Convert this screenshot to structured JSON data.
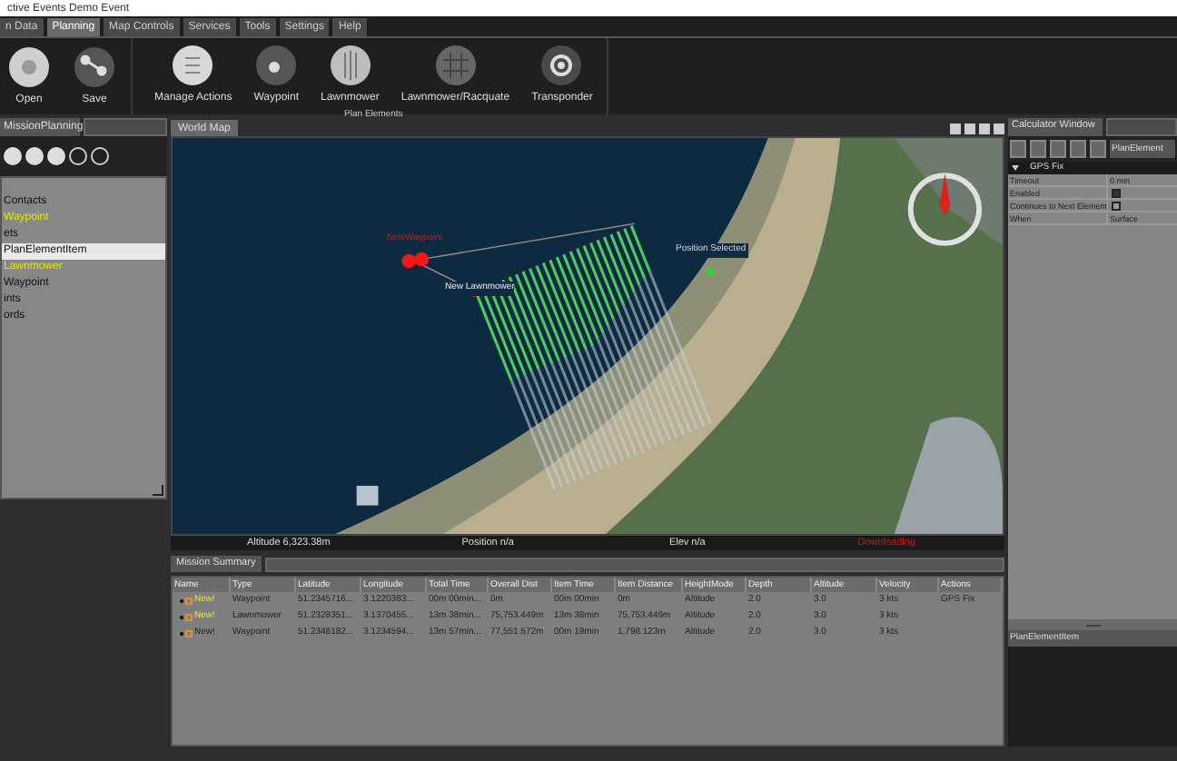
{
  "window": {
    "title": "ctive Events Demo Event"
  },
  "menu_tabs": [
    {
      "label": "n Data",
      "selected": false
    },
    {
      "label": "Planning",
      "selected": true
    },
    {
      "label": "Map Controls",
      "selected": false
    },
    {
      "label": "Services",
      "selected": false
    },
    {
      "label": "Tools",
      "selected": false
    },
    {
      "label": "Settings",
      "selected": false
    },
    {
      "label": "Help",
      "selected": false
    }
  ],
  "toolbar": {
    "file_buttons": [
      {
        "label": "Open",
        "kind": "open"
      },
      {
        "label": "Save",
        "kind": "save"
      }
    ],
    "plan_buttons": [
      {
        "label": "Manage Actions",
        "kind": "actions"
      },
      {
        "label": "Waypoint",
        "kind": "waypoint"
      },
      {
        "label": "Lawnmower",
        "kind": "lawnmower"
      },
      {
        "label": "Lawnmower/Racquate",
        "kind": "grid"
      },
      {
        "label": "Transponder",
        "kind": "transponder"
      }
    ],
    "group_label": "Plan Elements"
  },
  "left_panel": {
    "dropdown": "MissionPlanning",
    "items": [
      {
        "label": "Contacts",
        "selected": false,
        "color": "#111111"
      },
      {
        "label": "Waypoint",
        "selected": false,
        "color": "#e8e800"
      },
      {
        "label": "ets",
        "selected": false,
        "color": "#111111"
      },
      {
        "label": "PlanElementItem",
        "selected": true,
        "color": "#111111"
      },
      {
        "label": "Lawnmower",
        "selected": false,
        "color": "#e8e800"
      },
      {
        "label": "Waypoint",
        "selected": false,
        "color": "#111111"
      },
      {
        "label": "ints",
        "selected": false,
        "color": "#111111"
      },
      {
        "label": "ords",
        "selected": false,
        "color": "#111111"
      }
    ]
  },
  "map": {
    "tab": "World Map",
    "labels": {
      "waypoint": "NewWaypoint",
      "lawnmower": "New Lawnmower",
      "position": "Position Selected"
    },
    "status": [
      "Altitude 6,323.38m",
      "Position n/a",
      "Elev n/a"
    ],
    "download_status": "Downloading"
  },
  "mission_summary": {
    "title": "Mission Summary",
    "columns": [
      "Name",
      "Type",
      "Latitude",
      "Longitude",
      "Total Time",
      "Overall Dist",
      "Item Time",
      "Item Distance",
      "HeightMode",
      "Depth",
      "Altitude",
      "Velocity",
      "Actions"
    ],
    "rows": [
      {
        "highlighted": true,
        "cells": [
          "New!",
          "Waypoint",
          "51.2345716...",
          "3.1220383...",
          "00m 00min...",
          "0m",
          "00m 00min",
          "0m",
          "Altitude",
          "2.0",
          "3.0",
          "3 kts",
          "GPS Fix"
        ]
      },
      {
        "highlighted": true,
        "cells": [
          "New!",
          "Lawnmower",
          "51.2328351...",
          "3.1370455...",
          "13m 38min...",
          "75,753.449m",
          "13m 38min",
          "75,753.449m",
          "Altitude",
          "2.0",
          "3.0",
          "3 kts",
          ""
        ]
      },
      {
        "highlighted": false,
        "cells": [
          "New!",
          "Waypoint",
          "51.2348182...",
          "3.1234594...",
          "13m 57min...",
          "77,551.572m",
          "00m 19min",
          "1,798.123m",
          "Altitude",
          "2.0",
          "3.0",
          "3 kts",
          ""
        ]
      }
    ]
  },
  "right_panel": {
    "dropdown": "Calculator Window",
    "element_button": "PlanElement",
    "section": "GPS Fix",
    "properties": [
      {
        "name": "Timeout",
        "kind": "text",
        "value": "0 min"
      },
      {
        "name": "Enabled",
        "kind": "checkbox",
        "checked": true
      },
      {
        "name": "Continues to Next Element",
        "kind": "checkbox",
        "checked": false
      },
      {
        "name": "When",
        "kind": "text",
        "value": "Surface"
      }
    ],
    "footer": "PlanElementItem"
  }
}
